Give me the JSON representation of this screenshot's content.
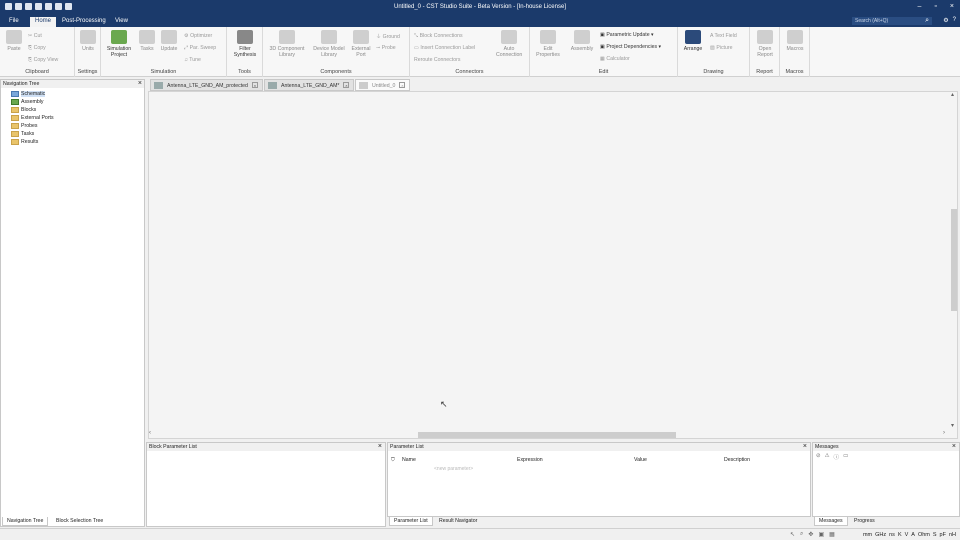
{
  "window": {
    "title": "Untitled_0 - CST Studio Suite - Beta Version - [In-house License]",
    "controls": [
      "–",
      "▫",
      "×"
    ]
  },
  "menu": {
    "tabs": [
      {
        "label": "File",
        "active": false
      },
      {
        "label": "Home",
        "active": true
      },
      {
        "label": "Post-Processing",
        "active": false
      },
      {
        "label": "View",
        "active": false
      }
    ],
    "search_placeholder": "Search (Alt+Q)"
  },
  "ribbon": {
    "clipboard": {
      "label": "Clipboard",
      "paste": "Paste",
      "cut": "Cut",
      "copy": "Copy",
      "copy_view": "Copy View"
    },
    "settings": {
      "label": "Settings",
      "units": "Units"
    },
    "simulation": {
      "label": "Simulation",
      "sim_project": "Simulation Project",
      "tasks": "Tasks",
      "update": "Update",
      "optimizer": "Optimizer",
      "par_sweep": "Par. Sweep",
      "tune": "Tune"
    },
    "tools": {
      "label": "Tools",
      "filter_synthesis": "Filter Synthesis"
    },
    "components": {
      "label": "Components",
      "comp_library": "3D Component Library",
      "device_model": "Device Model Library",
      "external_port": "External Port",
      "ground": "Ground",
      "probe": "Probe"
    },
    "connectors": {
      "label": "Connectors",
      "block_connections": "Block Connections",
      "insert_connection_label": "Insert Connection Label",
      "reroute_connectors": "Reroute Connectors",
      "auto_connection": "Auto Connection"
    },
    "edit": {
      "label": "Edit",
      "edit_properties": "Edit Properties",
      "assembly": "Assembly",
      "parametric_update": "Parametric Update",
      "project_dependencies": "Project Dependencies",
      "calculator": "Calculator"
    },
    "drawing": {
      "label": "Drawing",
      "arrange": "Arrange",
      "text_field": "Text Field",
      "picture": "Picture"
    },
    "report": {
      "label": "Report",
      "open_report": "Open Report"
    },
    "macros": {
      "label": "Macros",
      "macros": "Macros"
    }
  },
  "doc_tabs": [
    {
      "label": "Antenna_LTE_GND_AM_protected",
      "active": false
    },
    {
      "label": "Antenna_LTE_GND_AM*",
      "active": false
    },
    {
      "label": "Untitled_0",
      "active": true
    }
  ],
  "nav_tree": {
    "title": "Navigation Tree",
    "items": [
      "Schematic",
      "Assembly",
      "Blocks",
      "External Ports",
      "Probes",
      "Tasks",
      "Results"
    ],
    "bottom_tabs": [
      "Navigation Tree",
      "Block Selection Tree"
    ]
  },
  "block_param": {
    "title": "Block Parameter List"
  },
  "param_list": {
    "title": "Parameter List",
    "columns": [
      "Name",
      "Expression",
      "Value",
      "Description"
    ],
    "new_placeholder": "<new parameter>",
    "bottom_tabs": [
      "Parameter List",
      "Result Navigator"
    ]
  },
  "messages": {
    "title": "Messages",
    "bottom_tabs": [
      "Messages",
      "Progress"
    ]
  },
  "status": {
    "units": [
      "mm",
      "GHz",
      "ns",
      "K",
      "V",
      "A",
      "Ohm",
      "S",
      "pF",
      "nH"
    ]
  }
}
